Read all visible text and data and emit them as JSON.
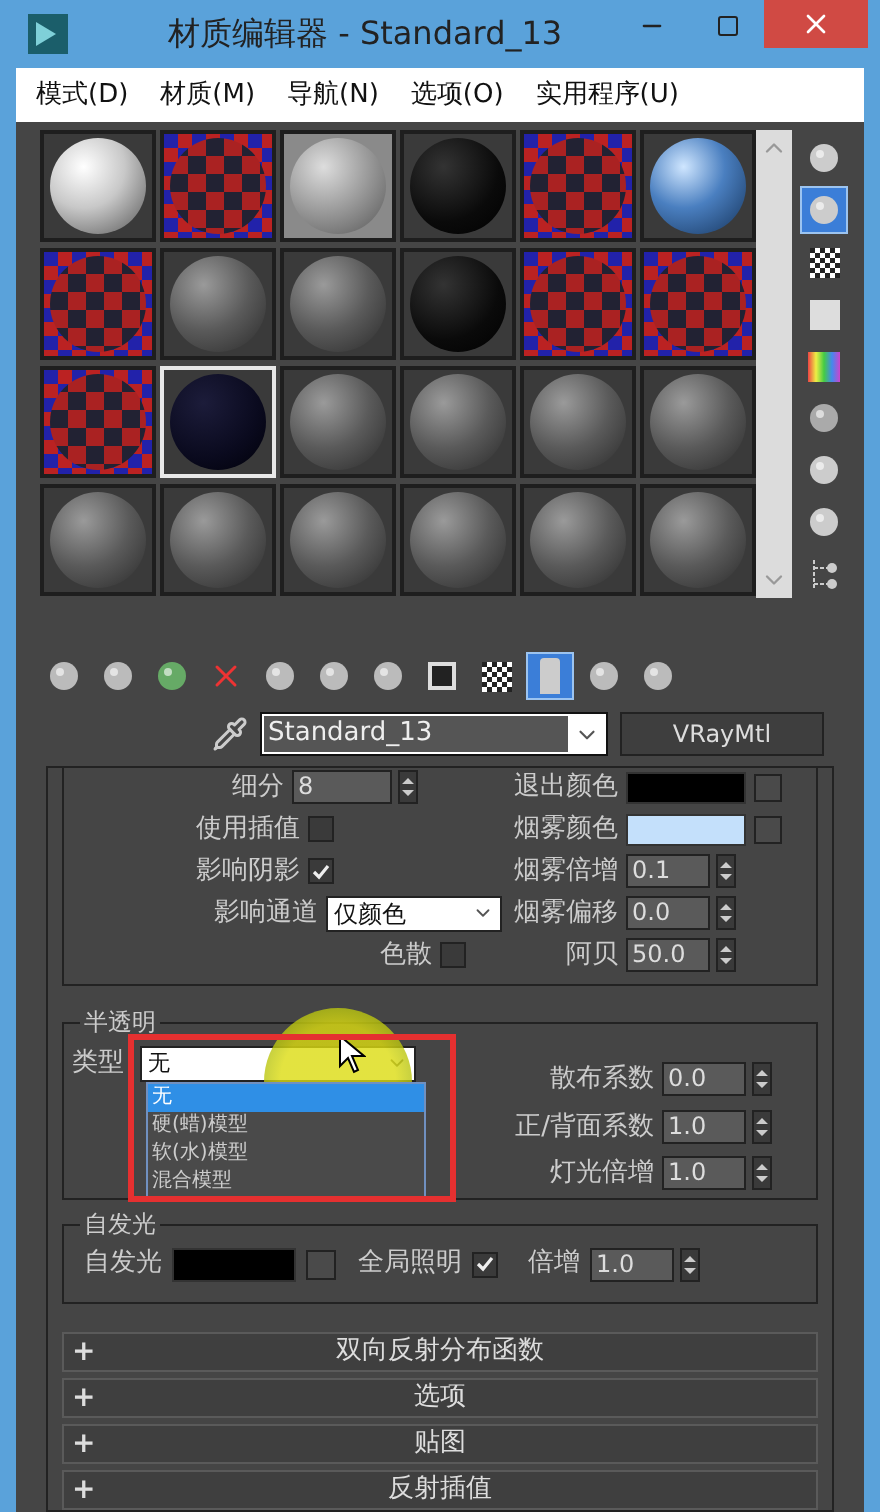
{
  "window": {
    "title": "材质编辑器 - Standard_13"
  },
  "menu": [
    "模式(D)",
    "材质(M)",
    "导航(N)",
    "选项(O)",
    "实用程序(U)"
  ],
  "slots": [
    {
      "kind": "white",
      "selected": false
    },
    {
      "kind": "checker",
      "selected": false
    },
    {
      "kind": "photo",
      "selected": false
    },
    {
      "kind": "black",
      "selected": false
    },
    {
      "kind": "checker",
      "selected": false
    },
    {
      "kind": "blue",
      "selected": false
    },
    {
      "kind": "checker",
      "selected": false
    },
    {
      "kind": "gray",
      "selected": false
    },
    {
      "kind": "gray",
      "selected": false
    },
    {
      "kind": "black",
      "selected": false
    },
    {
      "kind": "checker",
      "selected": false
    },
    {
      "kind": "checker",
      "selected": false
    },
    {
      "kind": "checker",
      "selected": false
    },
    {
      "kind": "navy",
      "selected": true
    },
    {
      "kind": "gray",
      "selected": false
    },
    {
      "kind": "gray",
      "selected": false
    },
    {
      "kind": "gray",
      "selected": false
    },
    {
      "kind": "gray",
      "selected": false
    },
    {
      "kind": "gray",
      "selected": false
    },
    {
      "kind": "gray",
      "selected": false
    },
    {
      "kind": "gray",
      "selected": false
    },
    {
      "kind": "gray",
      "selected": false
    },
    {
      "kind": "gray",
      "selected": false
    },
    {
      "kind": "gray",
      "selected": false
    }
  ],
  "side_tools": [
    {
      "selected": false
    },
    {
      "selected": true
    },
    {
      "selected": false
    },
    {
      "selected": false
    },
    {
      "selected": false
    },
    {
      "selected": false
    },
    {
      "selected": false
    },
    {
      "selected": false
    },
    {
      "selected": false
    }
  ],
  "toolbar": [
    {
      "selected": false
    },
    {
      "selected": false
    },
    {
      "selected": false
    },
    {
      "selected": false
    },
    {
      "selected": false
    },
    {
      "selected": false
    },
    {
      "selected": false
    },
    {
      "selected": false
    },
    {
      "selected": false
    },
    {
      "selected": true
    },
    {
      "selected": false
    },
    {
      "selected": false
    }
  ],
  "material": {
    "name": "Standard_13",
    "type": "VRayMtl"
  },
  "refraction": {
    "left": [
      {
        "kind": "spinner",
        "label": "细分",
        "value": "8"
      },
      {
        "kind": "checkbox",
        "label": "使用插值",
        "checked": false
      },
      {
        "kind": "checkbox",
        "label": "影响阴影",
        "checked": true
      },
      {
        "kind": "dropdown",
        "label": "影响通道",
        "value": "仅颜色"
      },
      {
        "kind": "checkbox",
        "label": "色散",
        "checked": false
      }
    ],
    "right": [
      {
        "kind": "color",
        "label": "退出颜色",
        "color": "#000000"
      },
      {
        "kind": "color",
        "label": "烟雾颜色",
        "color": "#c4e0fb"
      },
      {
        "kind": "spinner",
        "label": "烟雾倍增",
        "value": "0.1"
      },
      {
        "kind": "spinner",
        "label": "烟雾偏移",
        "value": "0.0"
      },
      {
        "kind": "spinner",
        "label": "阿贝",
        "value": "50.0"
      }
    ]
  },
  "translucency": {
    "title": "半透明",
    "type_label": "类型",
    "type_value": "无",
    "expanded": true,
    "options": [
      {
        "label": "无",
        "selected": true
      },
      {
        "label": "硬(蜡)模型",
        "selected": false
      },
      {
        "label": "软(水)模型",
        "selected": false
      },
      {
        "label": "混合模型",
        "selected": false
      }
    ],
    "right": [
      {
        "label": "散布系数",
        "value": "0.0"
      },
      {
        "label": "正/背面系数",
        "value": "1.0"
      },
      {
        "label": "灯光倍增",
        "value": "1.0"
      }
    ]
  },
  "self_illumination": {
    "title": "自发光",
    "label": "自发光",
    "color": "#000000",
    "gi_label": "全局照明",
    "gi_checked": true,
    "mult_label": "倍增",
    "mult_value": "1.0"
  },
  "rollouts": [
    {
      "sign": "+",
      "label": "双向反射分布函数"
    },
    {
      "sign": "+",
      "label": "选项"
    },
    {
      "sign": "+",
      "label": "贴图"
    },
    {
      "sign": "+",
      "label": "反射插值"
    }
  ]
}
